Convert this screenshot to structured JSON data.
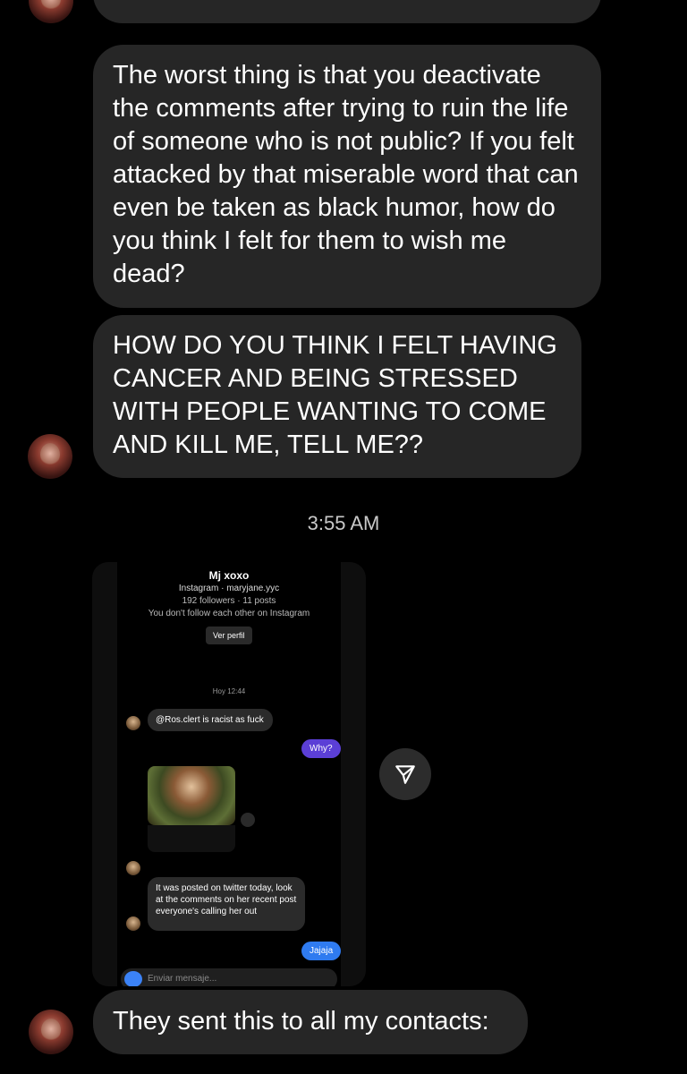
{
  "messages": [
    {
      "text": "The worst thing is that you deactivate the comments after trying to ruin the life of someone who is not public?  If you felt attacked by that miserable word that can even be taken as black humor, how do you think I felt for them to wish me dead?"
    },
    {
      "text": "HOW DO YOU THINK I FELT HAVING CANCER AND BEING STRESSED WITH PEOPLE WANTING TO COME AND KILL ME, TELL ME??"
    },
    {
      "text": "They sent this to all my contacts:"
    }
  ],
  "timestamp": "3:55 AM",
  "shared_screenshot": {
    "profile_name": "Mj xoxo",
    "handle": "Instagram · maryjane.yyc",
    "stats": "192 followers · 11 posts",
    "follow_note": "You don't follow each other on Instagram",
    "view_profile": "Ver perfil",
    "time": "Hoy 12:44",
    "msg1": "@Ros.clert is racist as fuck",
    "reply1": "Why?",
    "msg2": "It was posted on twitter today, look at the comments on her recent post everyone's calling her out",
    "reply2": "Jajaja",
    "input_placeholder": "Enviar mensaje..."
  },
  "colors": {
    "background": "#000000",
    "bubble": "#262626",
    "sent_purple": "#5b3fd6",
    "sent_blue": "#2f7bf0"
  }
}
